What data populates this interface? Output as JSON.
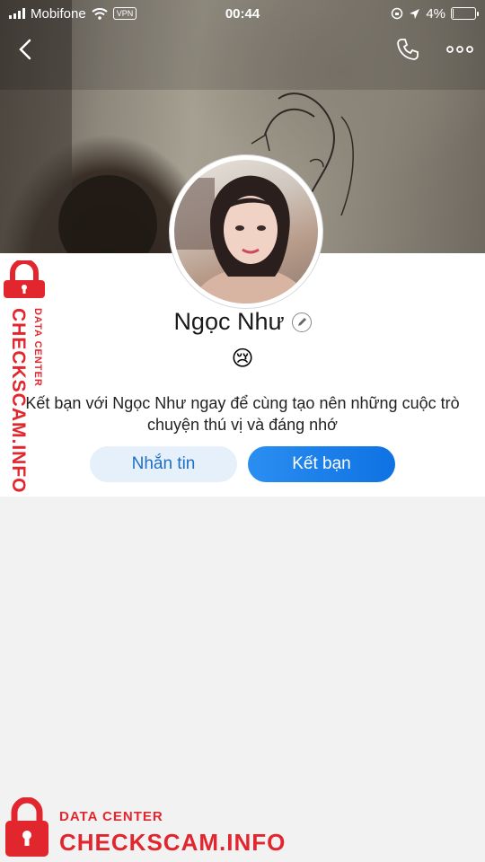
{
  "status_bar": {
    "carrier": "Mobifone",
    "vpn": "VPN",
    "time": "00:44",
    "battery_text": "4%",
    "battery_level": 0.04
  },
  "nav": {
    "back_icon": "chevron-left-icon",
    "call_icon": "phone-icon",
    "more_icon": "more-dots-icon"
  },
  "profile": {
    "name": "Ngọc Như",
    "status_emoji": "😢",
    "intro": "Kết bạn với Ngọc Như ngay để cùng tạo nên những cuộc trò chuyện thú vị và đáng nhớ",
    "message_button": "Nhắn tin",
    "add_friend_button": "Kết bạn"
  },
  "watermark": {
    "small_text": "DATA CENTER",
    "big_text": "CHECKSCAM.INFO",
    "color": "#e2262e"
  },
  "colors": {
    "primary_blue": "#0f72e3",
    "light_blue": "#e5f0fb",
    "background": "#f2f2f3"
  }
}
